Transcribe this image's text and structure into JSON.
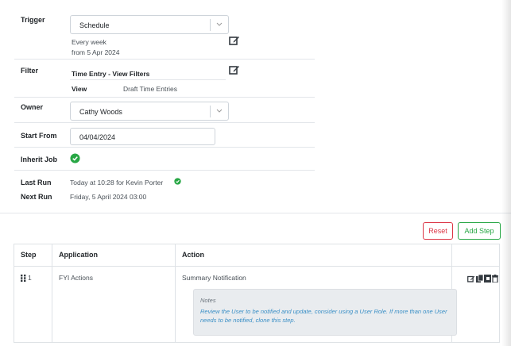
{
  "form": {
    "trigger": {
      "label": "Trigger",
      "value": "Schedule",
      "summary_line1": "Every week",
      "summary_line2": "from 5 Apr 2024"
    },
    "filter": {
      "label": "Filter",
      "value": "Time Entry - View Filters",
      "view_label": "View",
      "view_value": "Draft Time Entries"
    },
    "owner": {
      "label": "Owner",
      "value": "Cathy Woods"
    },
    "start_from": {
      "label": "Start From",
      "value": "04/04/2024"
    },
    "inherit_job": {
      "label": "Inherit Job",
      "checked": true
    },
    "last_run": {
      "label": "Last Run",
      "value": "Today at 10:28 for Kevin Porter"
    },
    "next_run": {
      "label": "Next Run",
      "value": "Friday, 5 April 2024 03:00"
    }
  },
  "buttons": {
    "reset": "Reset",
    "add_step": "Add Step"
  },
  "table": {
    "headers": [
      "Step",
      "Application",
      "Action",
      ""
    ],
    "rows": [
      {
        "step": "1",
        "application": "FYI Actions",
        "action": "Summary Notification",
        "notes_title": "Notes",
        "notes_body": "Review the User to be notified and update, consider using a User Role. If more than one User needs to be notified, clone this step."
      }
    ]
  },
  "colors": {
    "reset": "#dc3545",
    "add_step": "#28a745",
    "check": "#28a745",
    "notes_text": "#3a8fc6"
  },
  "icons": [
    "edit-icon",
    "chevron-down-icon",
    "check-circle-icon",
    "drag-handle-icon",
    "copy-icon",
    "clone-icon",
    "delete-icon"
  ]
}
